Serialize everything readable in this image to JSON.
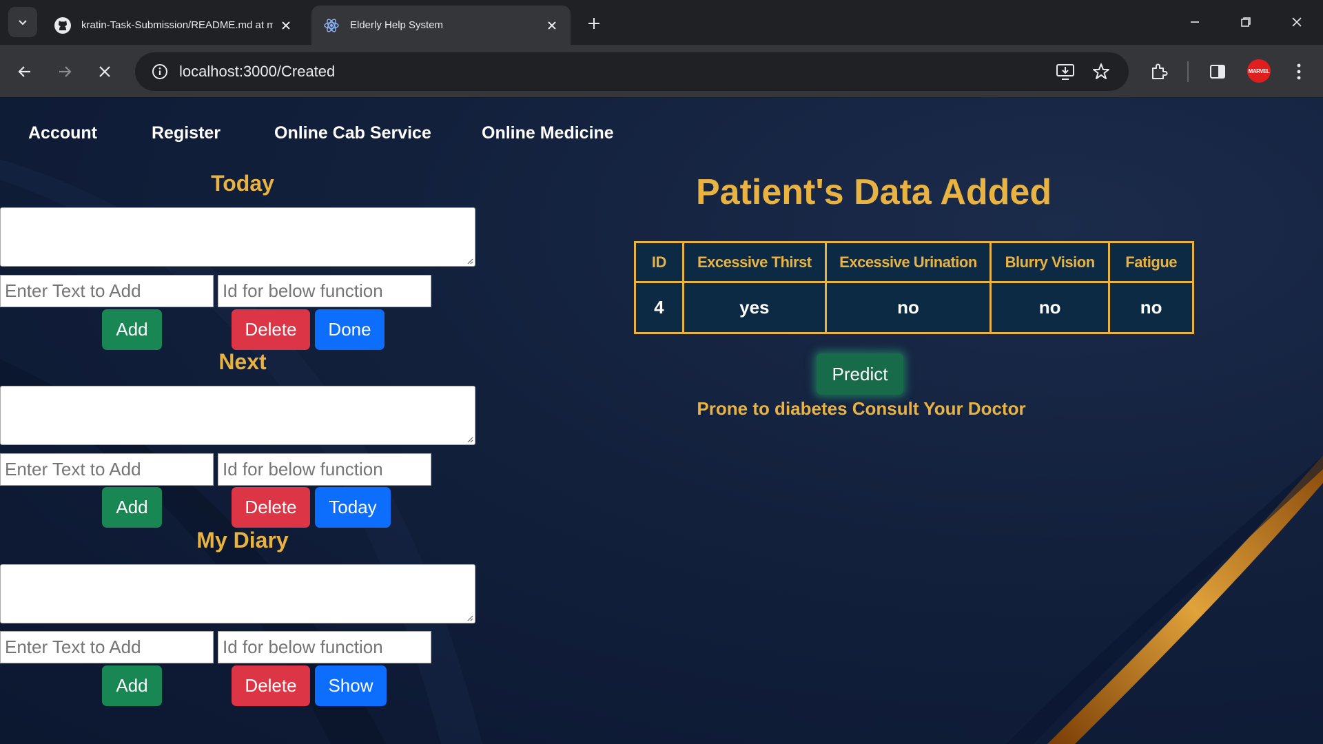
{
  "browser": {
    "tabs": [
      {
        "title": "kratin-Task-Submission/README.md at m",
        "icon": "github-icon",
        "active": false
      },
      {
        "title": "Elderly Help System",
        "icon": "react-icon",
        "active": true
      }
    ],
    "url": "localhost:3000/Created",
    "profile_label": "MARVEL"
  },
  "navbar": {
    "links": [
      "Account",
      "Register",
      "Online Cab Service",
      "Online Medicine"
    ]
  },
  "sections": [
    {
      "title": "Today",
      "text_placeholder": "Enter Text to Add",
      "id_placeholder": "Id for below function",
      "add_label": "Add",
      "delete_label": "Delete",
      "action_label": "Done"
    },
    {
      "title": "Next",
      "text_placeholder": "Enter Text to Add",
      "id_placeholder": "Id for below function",
      "add_label": "Add",
      "delete_label": "Delete",
      "action_label": "Today"
    },
    {
      "title": "My Diary",
      "text_placeholder": "Enter Text to Add",
      "id_placeholder": "Id for below function",
      "add_label": "Add",
      "delete_label": "Delete",
      "action_label": "Show"
    }
  ],
  "patient": {
    "title": "Patient's Data Added",
    "headers": [
      "ID",
      "Excessive Thirst",
      "Excessive Urination",
      "Blurry Vision",
      "Fatigue"
    ],
    "row": [
      "4",
      "yes",
      "no",
      "no",
      "no"
    ],
    "predict_label": "Predict",
    "result": "Prone to diabetes Consult Your Doctor"
  },
  "colors": {
    "accent_gold": "#e9b341",
    "add_green": "#198754",
    "delete_red": "#dc3545",
    "action_blue": "#0d6efd"
  }
}
